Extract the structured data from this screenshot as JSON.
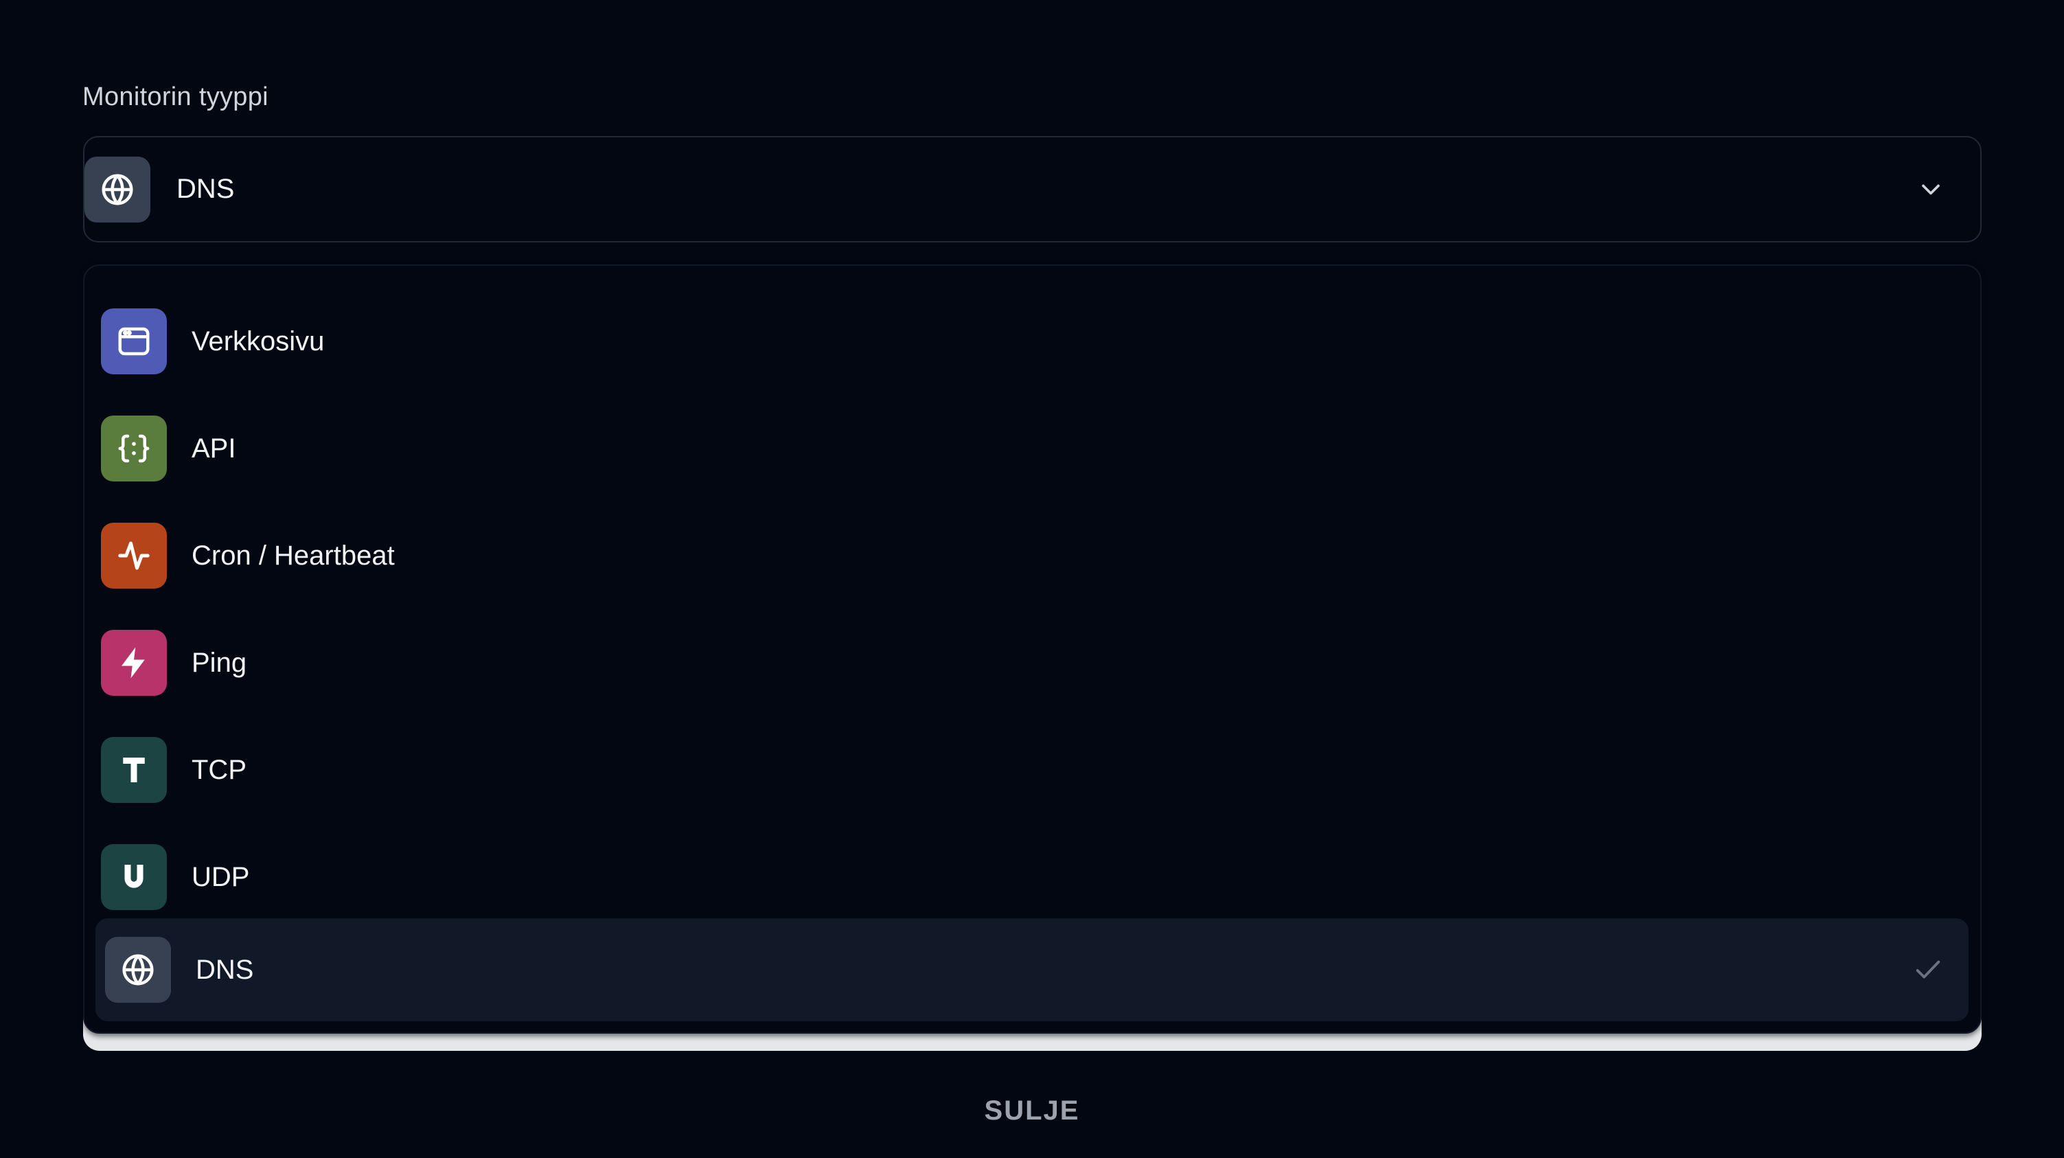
{
  "field": {
    "label": "Monitorin tyyppi",
    "selected_value": "DNS",
    "selected_icon": "globe-icon"
  },
  "options": [
    {
      "label": "Verkkosivu",
      "icon": "browser-window-icon",
      "color": "#4f5bb5"
    },
    {
      "label": "API",
      "icon": "curly-braces-icon",
      "color": "#5a7d3e"
    },
    {
      "label": "Cron / Heartbeat",
      "icon": "activity-pulse-icon",
      "color": "#b5441a"
    },
    {
      "label": "Ping",
      "icon": "lightning-bolt-icon",
      "color": "#b8336a"
    },
    {
      "label": "TCP",
      "icon": "letter-t-icon",
      "color": "#1b4443"
    },
    {
      "label": "UDP",
      "icon": "letter-u-icon",
      "color": "#1b4443"
    },
    {
      "label": "DNS",
      "icon": "globe-icon",
      "color": "#374151",
      "selected": true
    }
  ],
  "close_label": "SULJE"
}
